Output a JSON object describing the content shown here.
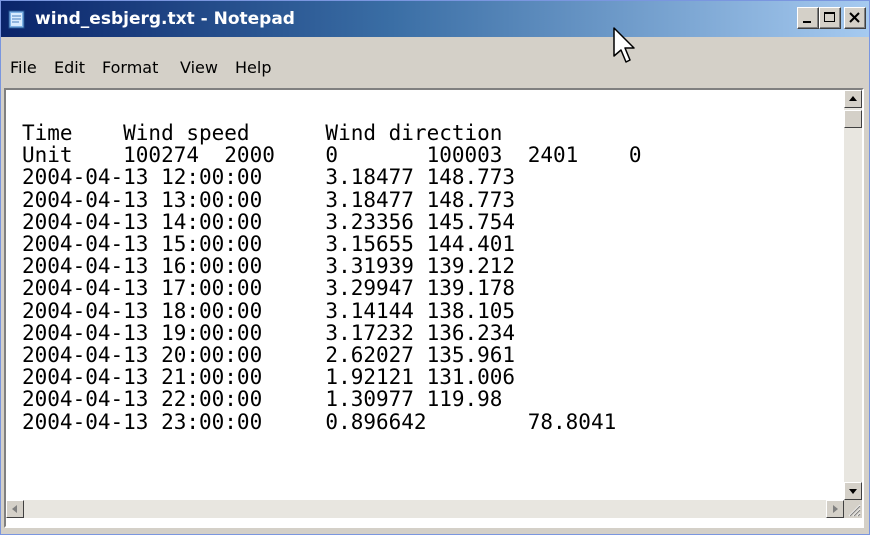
{
  "window": {
    "title": "wind_esbjerg.txt - Notepad",
    "titlebar_color": "#0a246a"
  },
  "menu": {
    "items": [
      "File",
      "Edit",
      "Format",
      "View",
      "Help"
    ]
  },
  "editor": {
    "lines": [
      "Time    Wind speed      Wind direction",
      "Unit    100274  2000    0       100003  2401    0",
      "2004-04-13 12:00:00     3.18477 148.773",
      "2004-04-13 13:00:00     3.18477 148.773",
      "2004-04-13 14:00:00     3.23356 145.754",
      "2004-04-13 15:00:00     3.15655 144.401",
      "2004-04-13 16:00:00     3.31939 139.212",
      "2004-04-13 17:00:00     3.29947 139.178",
      "2004-04-13 18:00:00     3.14144 138.105",
      "2004-04-13 19:00:00     3.17232 136.234",
      "2004-04-13 20:00:00     2.62027 135.961",
      "2004-04-13 21:00:00     1.92121 131.006",
      "2004-04-13 22:00:00     1.30977 119.98",
      "2004-04-13 23:00:00     0.896642        78.8041"
    ]
  },
  "icons": {
    "app": "notepad-icon",
    "minimize": "minimize-icon",
    "maximize": "maximize-icon",
    "close": "close-icon",
    "cursor": "mouse-pointer-icon"
  }
}
